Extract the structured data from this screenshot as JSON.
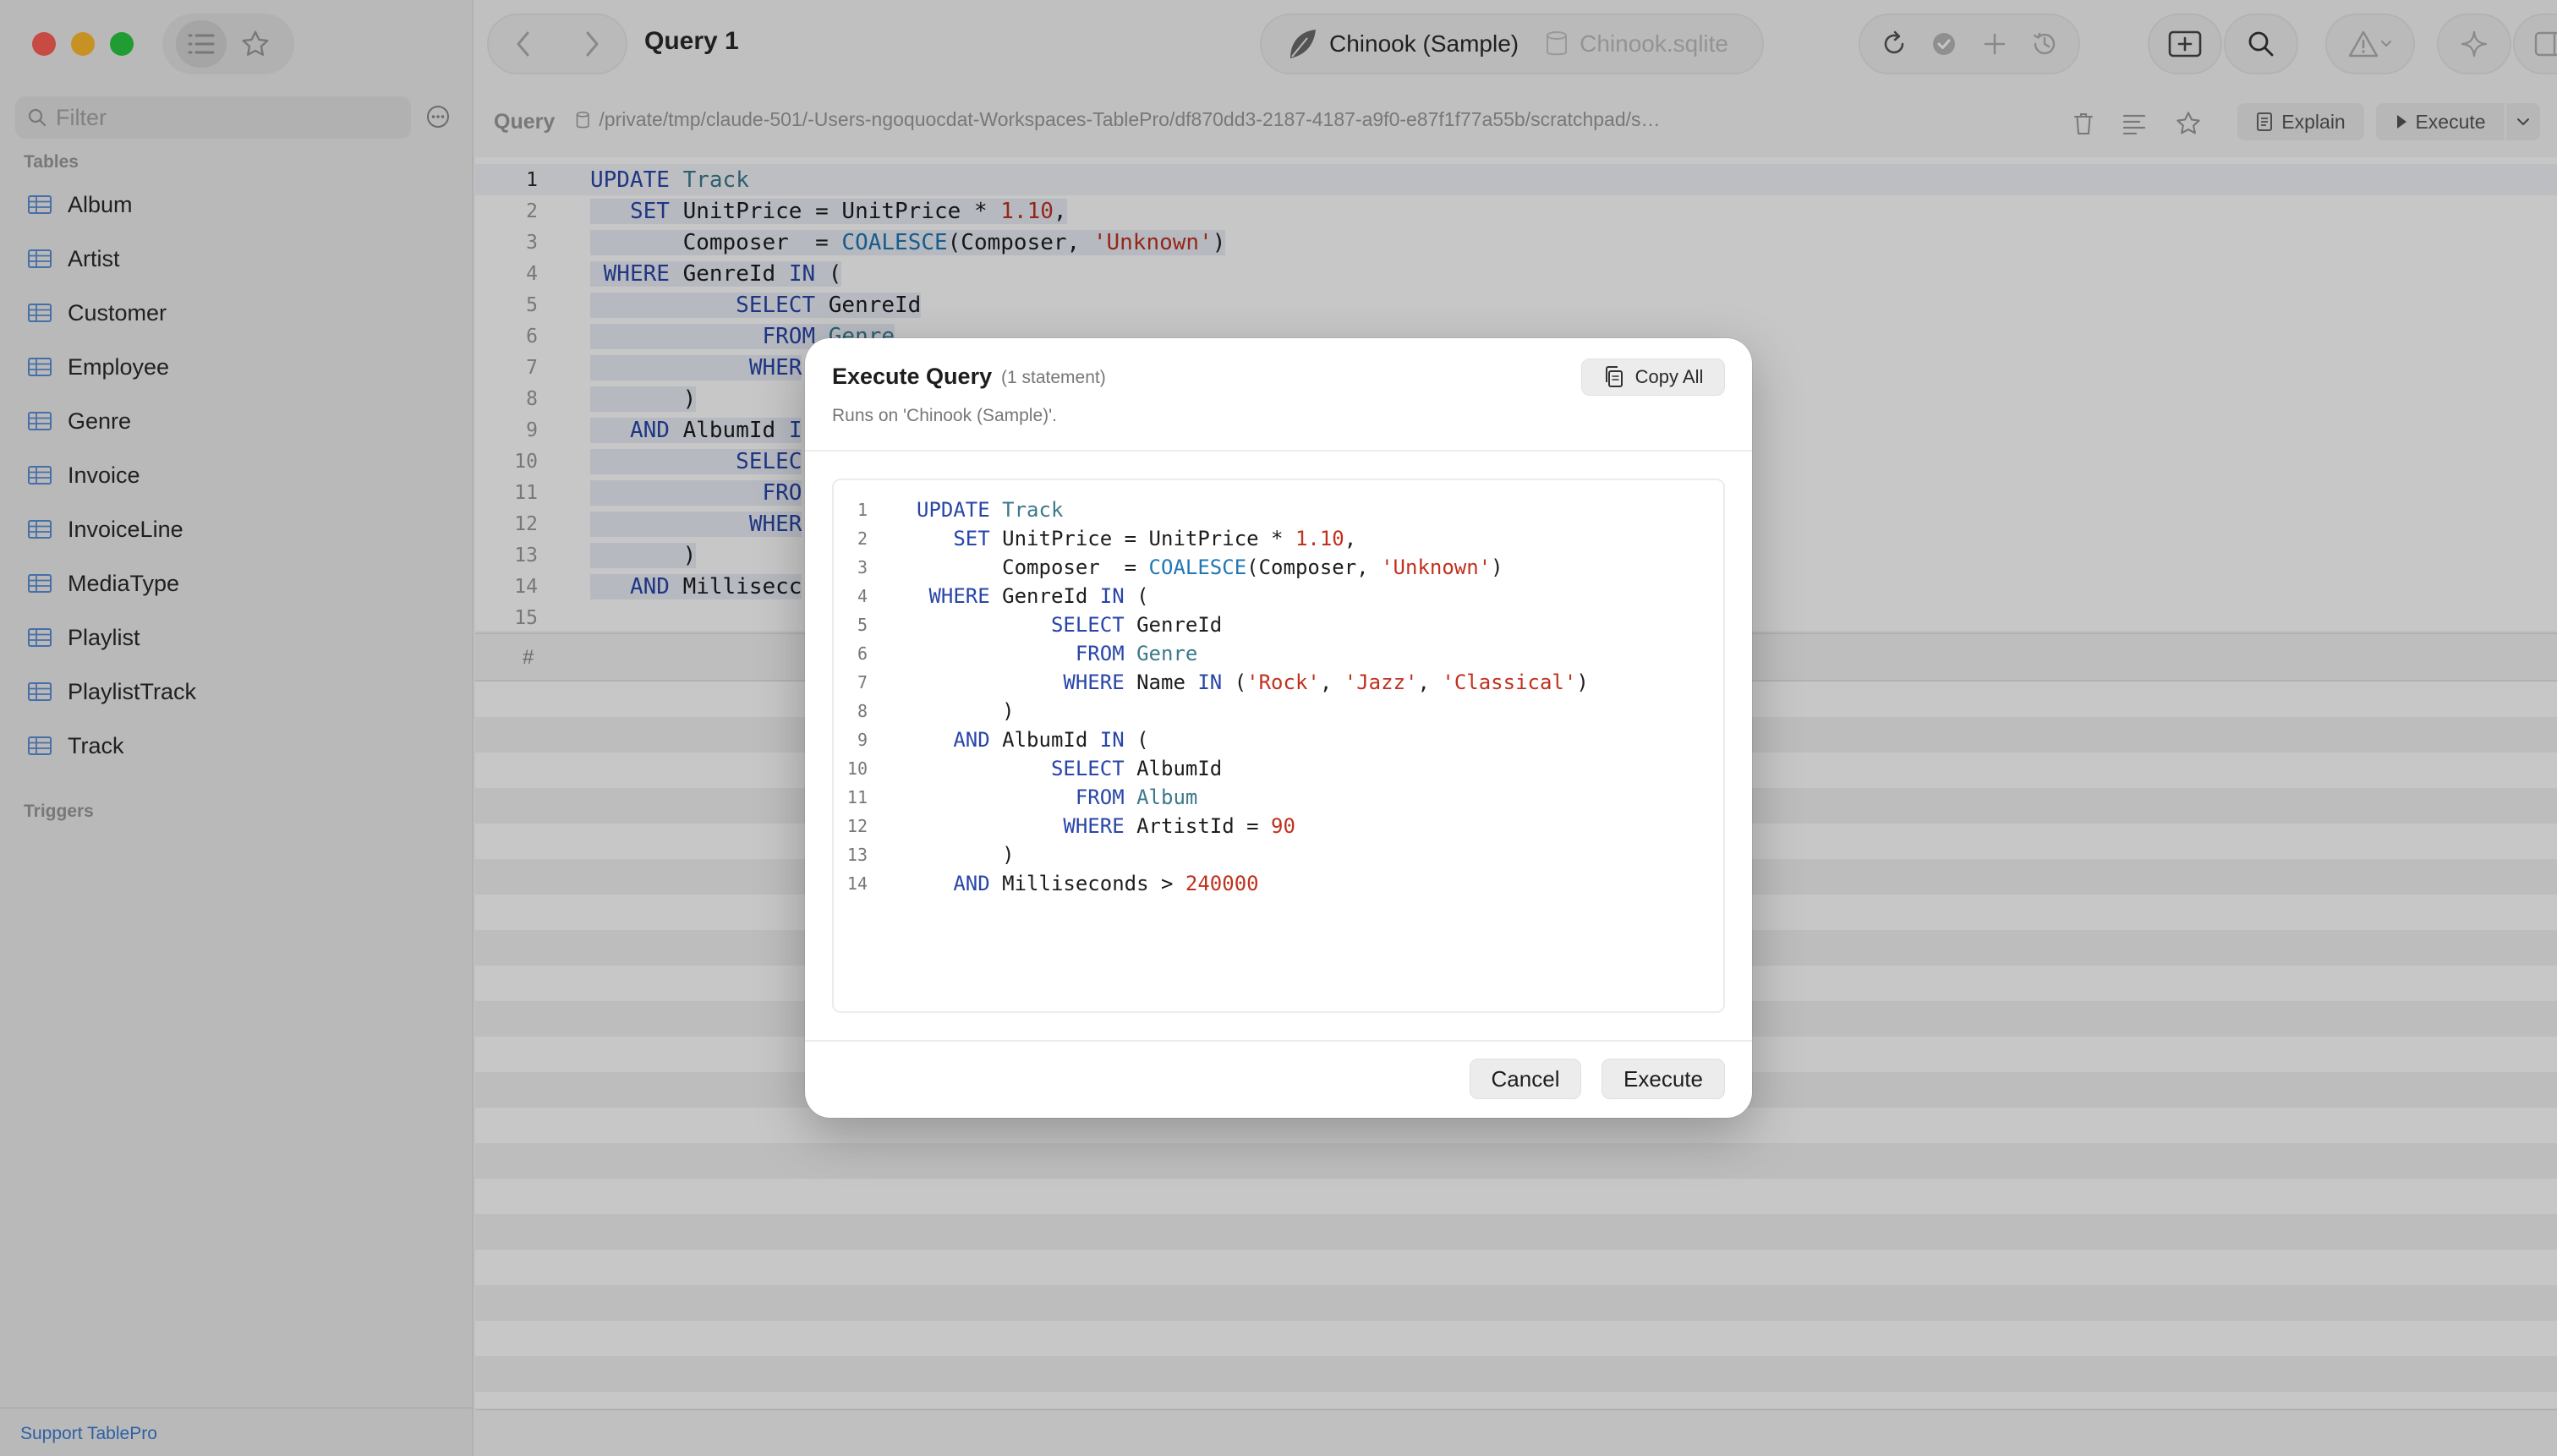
{
  "sidebar": {
    "filter_placeholder": "Filter",
    "tables_label": "Tables",
    "tables": [
      "Album",
      "Artist",
      "Customer",
      "Employee",
      "Genre",
      "Invoice",
      "InvoiceLine",
      "MediaType",
      "Playlist",
      "PlaylistTrack",
      "Track"
    ],
    "triggers_label": "Triggers",
    "support_link": "Support TablePro"
  },
  "toolbar": {
    "title": "Query 1",
    "connection_name": "Chinook (Sample)",
    "database_name": "Chinook.sqlite"
  },
  "query_bar": {
    "label": "Query",
    "path": "/private/tmp/claude-501/-Users-ngoquocdat-Workspaces-TablePro/df870dd3-2187-4187-a9f0-e87f1f77a55b/scratchpad/shot/sandbox/TablePro/Sa...",
    "explain_label": "Explain",
    "execute_label": "Execute"
  },
  "editor": {
    "line_numbers": [
      "1",
      "2",
      "3",
      "4",
      "5",
      "6",
      "7",
      "8",
      "9",
      "10",
      "11",
      "12",
      "13",
      "14",
      "15"
    ],
    "visible_lines": [
      [
        {
          "t": "UPDATE ",
          "c": "kw"
        },
        {
          "t": "Track",
          "c": "tb"
        }
      ],
      [
        {
          "t": "   SET ",
          "c": "kw"
        },
        {
          "t": "UnitPrice = UnitPrice * ",
          "c": ""
        },
        {
          "t": "1.10",
          "c": "num"
        },
        {
          "t": ",",
          "c": ""
        }
      ],
      [
        {
          "t": "       Composer  = ",
          "c": ""
        },
        {
          "t": "COALESCE",
          "c": "fn"
        },
        {
          "t": "(Composer, ",
          "c": ""
        },
        {
          "t": "'Unknown'",
          "c": "str"
        },
        {
          "t": ")",
          "c": ""
        }
      ],
      [
        {
          "t": " WHERE ",
          "c": "kw"
        },
        {
          "t": "GenreId ",
          "c": ""
        },
        {
          "t": "IN",
          "c": "kw"
        },
        {
          "t": " (",
          "c": ""
        }
      ],
      [
        {
          "t": "           SELECT ",
          "c": "kw"
        },
        {
          "t": "GenreId",
          "c": ""
        }
      ],
      [
        {
          "t": "             FROM ",
          "c": "kw"
        },
        {
          "t": "Genre",
          "c": "tb"
        }
      ],
      [
        {
          "t": "            WHER",
          "c": "kw"
        }
      ],
      [
        {
          "t": "       )",
          "c": ""
        }
      ],
      [
        {
          "t": "   AND ",
          "c": "kw"
        },
        {
          "t": "AlbumId ",
          "c": ""
        },
        {
          "t": "I",
          "c": "kw"
        }
      ],
      [
        {
          "t": "           SELEC",
          "c": "kw"
        }
      ],
      [
        {
          "t": "             FRO",
          "c": "kw"
        }
      ],
      [
        {
          "t": "            WHER",
          "c": "kw"
        }
      ],
      [
        {
          "t": "       )",
          "c": ""
        }
      ],
      [
        {
          "t": "   AND ",
          "c": "kw"
        },
        {
          "t": "Millisecc",
          "c": ""
        }
      ],
      []
    ]
  },
  "results": {
    "row_number_header": "#"
  },
  "modal": {
    "title": "Execute Query",
    "statement_count": "(1 statement)",
    "subtitle": "Runs on 'Chinook (Sample)'.",
    "copy_all_label": "Copy All",
    "cancel_label": "Cancel",
    "execute_label": "Execute",
    "line_numbers": [
      "1",
      "2",
      "3",
      "4",
      "5",
      "6",
      "7",
      "8",
      "9",
      "10",
      "11",
      "12",
      "13",
      "14"
    ],
    "code_lines": [
      [
        {
          "t": "UPDATE ",
          "c": "kw"
        },
        {
          "t": "Track",
          "c": "tb"
        }
      ],
      [
        {
          "t": "   SET ",
          "c": "kw"
        },
        {
          "t": "UnitPrice = UnitPrice * ",
          "c": ""
        },
        {
          "t": "1.10",
          "c": "num"
        },
        {
          "t": ",",
          "c": ""
        }
      ],
      [
        {
          "t": "       Composer  = ",
          "c": ""
        },
        {
          "t": "COALESCE",
          "c": "fn"
        },
        {
          "t": "(Composer, ",
          "c": ""
        },
        {
          "t": "'Unknown'",
          "c": "str"
        },
        {
          "t": ")",
          "c": ""
        }
      ],
      [
        {
          "t": " WHERE ",
          "c": "kw"
        },
        {
          "t": "GenreId ",
          "c": ""
        },
        {
          "t": "IN",
          "c": "kw"
        },
        {
          "t": " (",
          "c": ""
        }
      ],
      [
        {
          "t": "           SELECT ",
          "c": "kw"
        },
        {
          "t": "GenreId",
          "c": ""
        }
      ],
      [
        {
          "t": "             FROM ",
          "c": "kw"
        },
        {
          "t": "Genre",
          "c": "tb"
        }
      ],
      [
        {
          "t": "            WHERE ",
          "c": "kw"
        },
        {
          "t": "Name ",
          "c": ""
        },
        {
          "t": "IN",
          "c": "kw"
        },
        {
          "t": " (",
          "c": ""
        },
        {
          "t": "'Rock'",
          "c": "str"
        },
        {
          "t": ", ",
          "c": ""
        },
        {
          "t": "'Jazz'",
          "c": "str"
        },
        {
          "t": ", ",
          "c": ""
        },
        {
          "t": "'Classical'",
          "c": "str"
        },
        {
          "t": ")",
          "c": ""
        }
      ],
      [
        {
          "t": "       )",
          "c": ""
        }
      ],
      [
        {
          "t": "   AND ",
          "c": "kw"
        },
        {
          "t": "AlbumId ",
          "c": ""
        },
        {
          "t": "IN",
          "c": "kw"
        },
        {
          "t": " (",
          "c": ""
        }
      ],
      [
        {
          "t": "           SELECT ",
          "c": "kw"
        },
        {
          "t": "AlbumId",
          "c": ""
        }
      ],
      [
        {
          "t": "             FROM ",
          "c": "kw"
        },
        {
          "t": "Album",
          "c": "tb"
        }
      ],
      [
        {
          "t": "            WHERE ",
          "c": "kw"
        },
        {
          "t": "ArtistId = ",
          "c": ""
        },
        {
          "t": "90",
          "c": "num"
        }
      ],
      [
        {
          "t": "       )",
          "c": ""
        }
      ],
      [
        {
          "t": "   AND ",
          "c": "kw"
        },
        {
          "t": "Milliseconds > ",
          "c": ""
        },
        {
          "t": "240000",
          "c": "num"
        }
      ]
    ]
  },
  "colors": {
    "keyword": "#2846a8",
    "table": "#3b7a8c",
    "literal": "#c0311f",
    "function": "#1f77b4",
    "link": "#3a7bd5"
  },
  "icons": [
    "list-icon",
    "star-icon",
    "search-icon",
    "ellipsis-circle-icon",
    "table-grid-icon",
    "chevron-left-icon",
    "chevron-right-icon",
    "leaf-db-icon",
    "cylinder-db-icon",
    "refresh-icon",
    "check-circle-icon",
    "plus-icon",
    "history-icon",
    "new-tab-icon",
    "warning-icon",
    "sparkle-icon",
    "sidebar-toggle-icon",
    "trash-icon",
    "format-icon",
    "explain-doc-icon",
    "play-icon",
    "chevron-down-icon",
    "copy-icon"
  ]
}
